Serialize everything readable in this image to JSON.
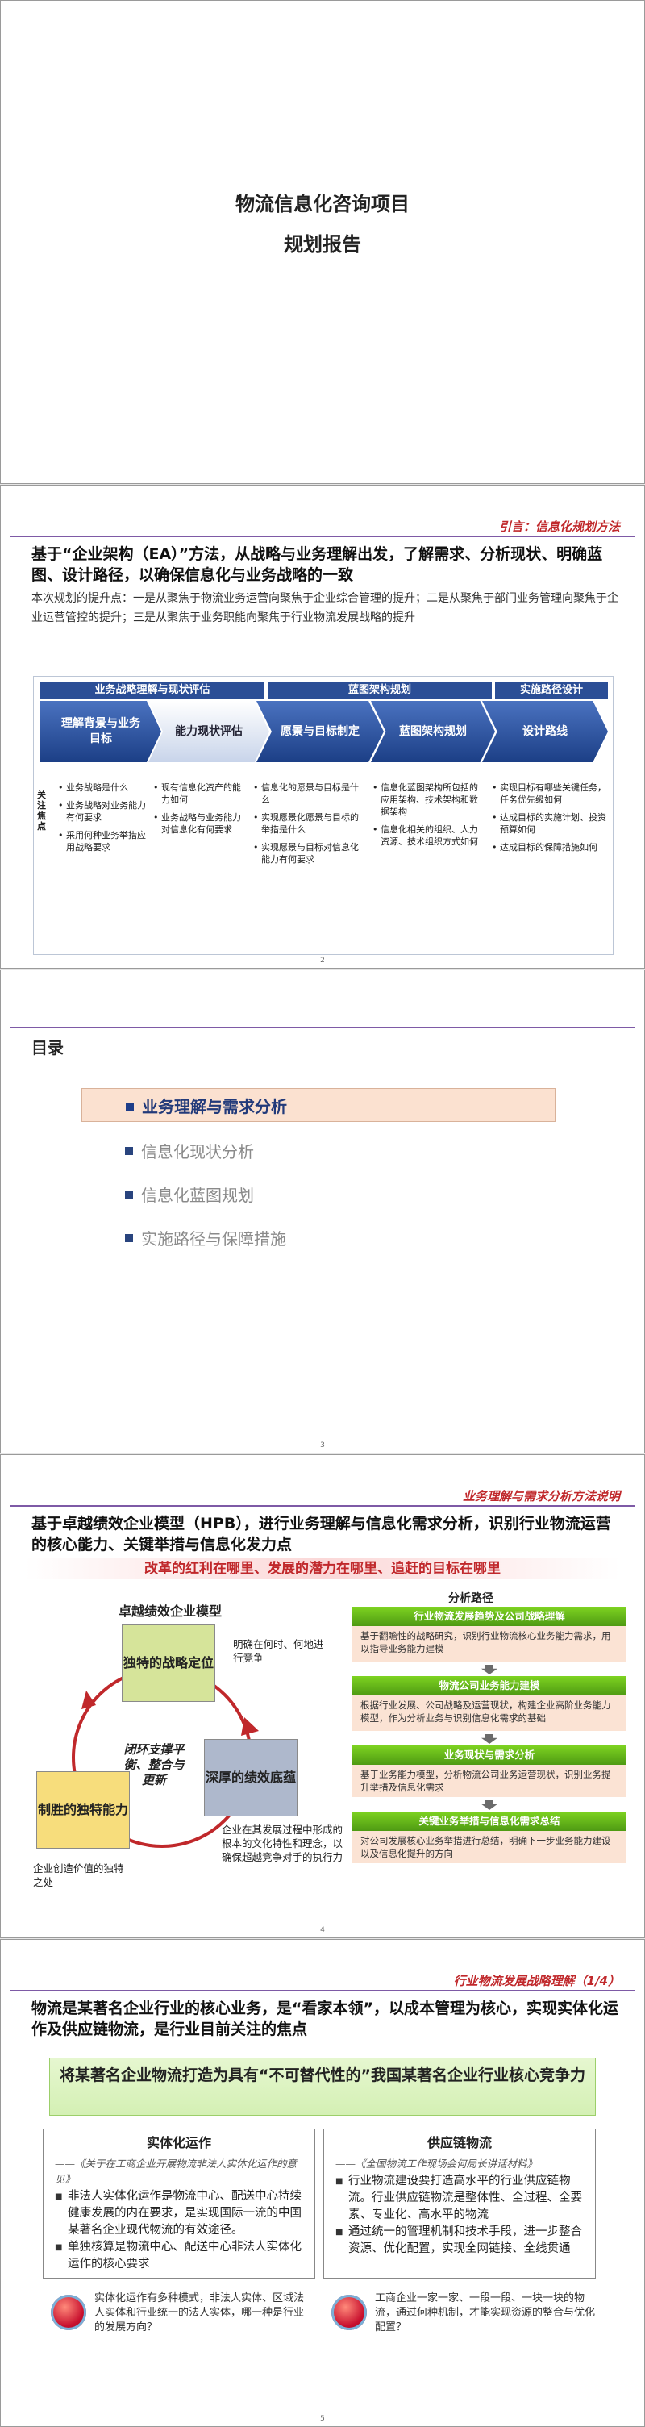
{
  "slide1": {
    "title_line1": "物流信息化咨询项目",
    "title_line2": "规划报告"
  },
  "slide2": {
    "tag": "引言：信息化规划方法",
    "title": "基于“企业架构（EA）”方法，从战略与业务理解出发，了解需求、分析现状、明确蓝图、设计路径，以确保信息化与业务战略的一致",
    "intro": "本次规划的提升点：一是从聚焦于物流业务运营向聚焦于企业综合管理的提升；二是从聚焦于部门业务管理向聚焦于企业运营管控的提升；三是从聚焦于业务职能向聚焦于行业物流发展战略的提升",
    "phases": [
      "业务战略理解与现状评估",
      "蓝图架构规划",
      "实施路径设计"
    ],
    "steps": [
      "理解背景与业务目标",
      "能力现状评估",
      "愿景与目标制定",
      "蓝图架构规划",
      "设计路线"
    ],
    "focus_label": "关注焦点",
    "focus": [
      [
        "业务战略是什么",
        "业务战略对业务能力有何要求",
        "采用何种业务举措应用战略要求"
      ],
      [
        "现有信息化资产的能力如何",
        "业务战略与业务能力对信息化有何要求"
      ],
      [
        "信息化的愿景与目标是什么",
        "实现愿景化愿景与目标的举措是什么",
        "实现愿景与目标对信息化能力有何要求"
      ],
      [
        "信息化蓝图架构所包括的应用架构、技术架构和数据架构",
        "信息化相关的组织、人力资源、技术组织方式如何"
      ],
      [
        "实现目标有哪些关键任务，任务优先级如何",
        "达成目标的实施计划、投资预算如何",
        "达成目标的保障措施如何"
      ]
    ],
    "page": "2"
  },
  "slide3": {
    "heading": "目录",
    "items": [
      "业务理解与需求分析",
      "信息化现状分析",
      "信息化蓝图规划",
      "实施路径与保障措施"
    ],
    "page": "3"
  },
  "slide4": {
    "tag": "业务理解与需求分析方法说明",
    "title": "基于卓越绩效企业模型（HPB），进行业务理解与信息化需求分析，识别行业物流运营的核心能力、关键举措与信息化发力点",
    "banner": "改革的红利在哪里、发展的潜力在哪里、追赶的目标在哪里",
    "model_title": "卓越绩效企业模型",
    "box_top": "独特的战略定位",
    "box_left": "制胜的独特能力",
    "box_right": "深厚的绩效底蕴",
    "note_top": "明确在何时、何地进行竞争",
    "note_left": "企业创造价值的独特之处",
    "note_right": "企业在其发展过程中形成的根本的文化特性和理念，以确保超越竞争对手的执行力",
    "center_text": "闭环支撑平衡、整合与更新",
    "path_title": "分析路径",
    "path": [
      {
        "h": "行业物流发展趋势及公司战略理解",
        "d": "基于翻瞻性的战略研究，识别行业物流核心业务能力需求，用以指导业务能力建模"
      },
      {
        "h": "物流公司业务能力建模",
        "d": "根据行业发展、公司战略及运营现状，构建企业高阶业务能力模型，作为分析业务与识别信息化需求的基础"
      },
      {
        "h": "业务现状与需求分析",
        "d": "基于业务能力模型，分析物流公司业务运营现状，识别业务提升举措及信息化需求"
      },
      {
        "h": "关键业务举措与信息化需求总结",
        "d": "对公司发展核心业务举措进行总结，明确下一步业务能力建设以及信息化提升的方向"
      }
    ],
    "page": "4"
  },
  "slide5": {
    "tag": "行业物流发展战略理解（1/4）",
    "title": "物流是某著名企业行业的核心业务，是“看家本领”，以成本管理为核心，实现实体化运作及供应链物流，是行业目前关注的焦点",
    "banner": "将某著名企业物流打造为具有“不可替代性的”我国某著名企业行业核心竞争力",
    "left": {
      "heading": "实体化运作",
      "quote": "——《关于在工商企业开展物流非法人实体化运作的意见》",
      "bullets": [
        "非法人实体化运作是物流中心、配送中心持续健康发展的内在要求，是实现国际一流的中国某著名企业现代物流的有效途径。",
        "单独核算是物流中心、配送中心非法人实体化运作的核心要求"
      ]
    },
    "right": {
      "heading": "供应链物流",
      "quote": "——《全国物流工作现场会何局长讲话材料》",
      "bullets": [
        "行业物流建设要打造高水平的行业供应链物流。行业供应链物流是整体性、全过程、全要素、专业化、高水平的物流",
        "通过统一的管理机制和技术手段，进一步整合资源、优化配置，实现全网链接、全线贯通"
      ]
    },
    "q_left": "实体化运作有多种模式，非法人实体、区域法人实体和行业统一的法人实体，哪一种是行业的发展方向？",
    "q_right": "工商企业一家一家、一段一段、一块一块的物流，通过何种机制，才能实现资源的整合与优化配置？",
    "page": "5"
  }
}
